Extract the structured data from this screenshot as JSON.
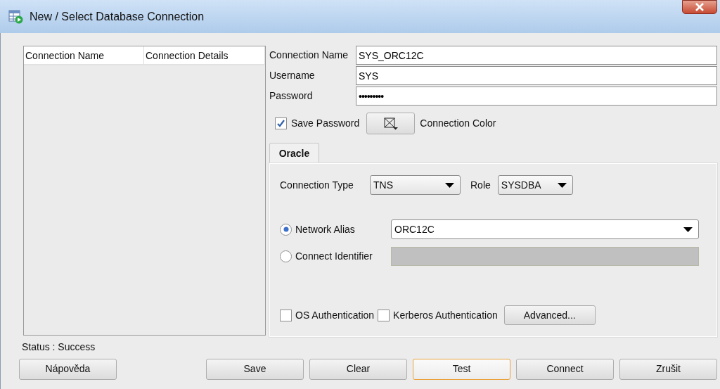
{
  "window": {
    "title": "New / Select Database Connection"
  },
  "connections_table": {
    "columns": [
      "Connection Name",
      "Connection Details"
    ]
  },
  "form": {
    "fields": [
      {
        "label": "Connection Name",
        "value": "SYS_ORC12C",
        "kind": "text"
      },
      {
        "label": "Username",
        "value": "SYS",
        "kind": "text"
      },
      {
        "label": "Password",
        "value": "•••••••••",
        "kind": "password"
      }
    ]
  },
  "save_password": {
    "label": "Save Password",
    "checked": true
  },
  "connection_color": {
    "label": "Connection Color"
  },
  "tabs": [
    {
      "label": "Oracle",
      "selected": true
    }
  ],
  "oracle": {
    "connection_type": {
      "label": "Connection Type",
      "value": "TNS"
    },
    "role": {
      "label": "Role",
      "value": "SYSDBA"
    },
    "options": [
      {
        "label": "Network Alias",
        "selected": true,
        "kind": "dropdown",
        "value": "ORC12C"
      },
      {
        "label": "Connect Identifier",
        "selected": false,
        "kind": "field",
        "disabled": true
      }
    ],
    "checkboxes": [
      {
        "label": "OS Authentication",
        "checked": false
      },
      {
        "label": "Kerberos Authentication",
        "checked": false
      }
    ],
    "advanced_button": "Advanced..."
  },
  "status": "Status : Success",
  "buttons": [
    {
      "label": "Nápověda",
      "focused": false
    },
    {
      "label": "Save",
      "focused": false
    },
    {
      "label": "Clear",
      "focused": false
    },
    {
      "label": "Test",
      "focused": true
    },
    {
      "label": "Connect",
      "focused": false
    },
    {
      "label": "Zrušit",
      "focused": false
    }
  ]
}
